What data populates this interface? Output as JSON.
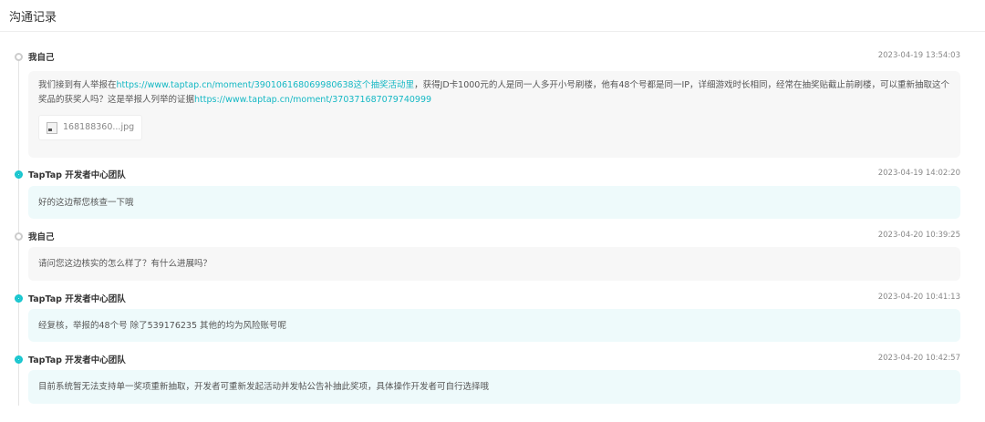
{
  "header": {
    "title": "沟通记录"
  },
  "entries": [
    {
      "author": "我自己",
      "time": "2023-04-19 13:54:03",
      "type": "self",
      "text_a": "我们接到有人举报在",
      "link_1": "https://www.taptap.cn/moment/390106168069980638这个抽奖活动里",
      "text_b": "，获得JD卡1000元的人是同一人多开小号刷楼，他有48个号都是同一IP，详细游戏时长相同，经常在抽奖贴截止前刷楼，可以重新抽取这个奖品的获奖人吗？这是举报人列举的证据",
      "link_2": "https://www.taptap.cn/moment/370371687079740999",
      "attachment": "168188360...jpg"
    },
    {
      "author": "TapTap 开发者中心团队",
      "time": "2023-04-19 14:02:20",
      "type": "team",
      "text": "好的这边帮您核查一下哦"
    },
    {
      "author": "我自己",
      "time": "2023-04-20 10:39:25",
      "type": "self",
      "text": "请问您这边核实的怎么样了？有什么进展吗？"
    },
    {
      "author": "TapTap 开发者中心团队",
      "time": "2023-04-20 10:41:13",
      "type": "team",
      "text": "经复核，举报的48个号 除了539176235 其他的均为风险账号呢"
    },
    {
      "author": "TapTap 开发者中心团队",
      "time": "2023-04-20 10:42:57",
      "type": "team",
      "text": "目前系统暂无法支持单一奖项重新抽取，开发者可重新发起活动并发帖公告补抽此奖项，具体操作开发者可自行选择哦"
    }
  ]
}
